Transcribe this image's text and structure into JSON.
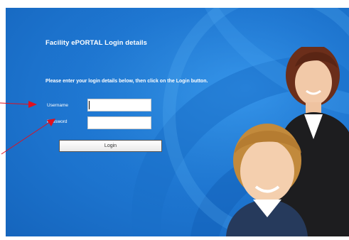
{
  "login": {
    "title": "Facility ePORTAL Login details",
    "instructions": "Please enter your login details below, then click on the Login button.",
    "username_label": "Username",
    "password_label": "Password",
    "username_value": "",
    "password_value": "",
    "login_button": "Login"
  },
  "colors": {
    "background_blue": "#1f78d3",
    "annotation_arrow": "#e0101e"
  },
  "images": {
    "hero": "mother-and-son-photo"
  }
}
